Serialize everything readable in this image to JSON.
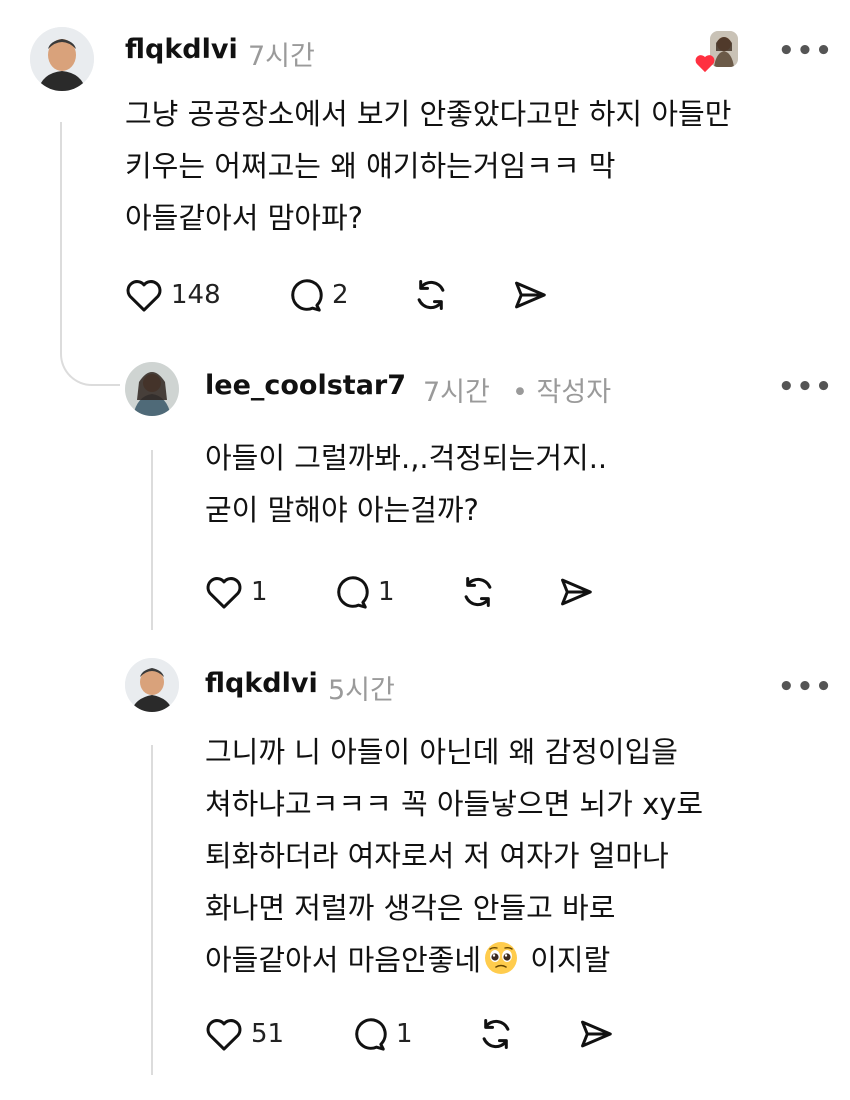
{
  "comments": [
    {
      "username": "flqkdlvi",
      "time": "7시간",
      "lines": [
        "그냥 공공장소에서 보기 안좋았다고만 하지 아들만",
        "키우는 어쩌고는 왜 얘기하는거임ㅋㅋ 막",
        "아들같아서 맘아파?"
      ],
      "likes": "148",
      "replies": "2"
    },
    {
      "username": "lee_coolstar7",
      "time": "7시간",
      "author_badge": "• 작성자",
      "lines": [
        "아들이 그럴까봐.,.걱정되는거지..",
        "굳이 말해야 아는걸까?"
      ],
      "likes": "1",
      "replies": "1"
    },
    {
      "username": "flqkdlvi",
      "time": "5시간",
      "lines": [
        "그니까 니 아들이 아닌데 왜 감정이입을",
        "쳐하냐고ㅋㅋㅋ 꼭 아들낳으면 뇌가 xy로",
        "퇴화하더라 여자로서 저 여자가 얼마나",
        "화나면 저럴까 생각은 안들고 바로"
      ],
      "last_line_before_emoji": "아들같아서 마음안좋네",
      "last_line_after_emoji": " 이지랄",
      "likes": "51",
      "replies": "1"
    }
  ],
  "icons": {
    "like": "heart-icon",
    "reply": "comment-bubble-icon",
    "repost": "repost-icon",
    "share": "send-icon",
    "more": "more-options-icon",
    "liked_by_author": "heart-badge-icon",
    "emoji": "pleading-face-emoji"
  },
  "colors": {
    "text": "#111111",
    "muted": "#9a9a9a",
    "heart_badge": "#ff3040",
    "thread_line": "#dcdcdc"
  }
}
